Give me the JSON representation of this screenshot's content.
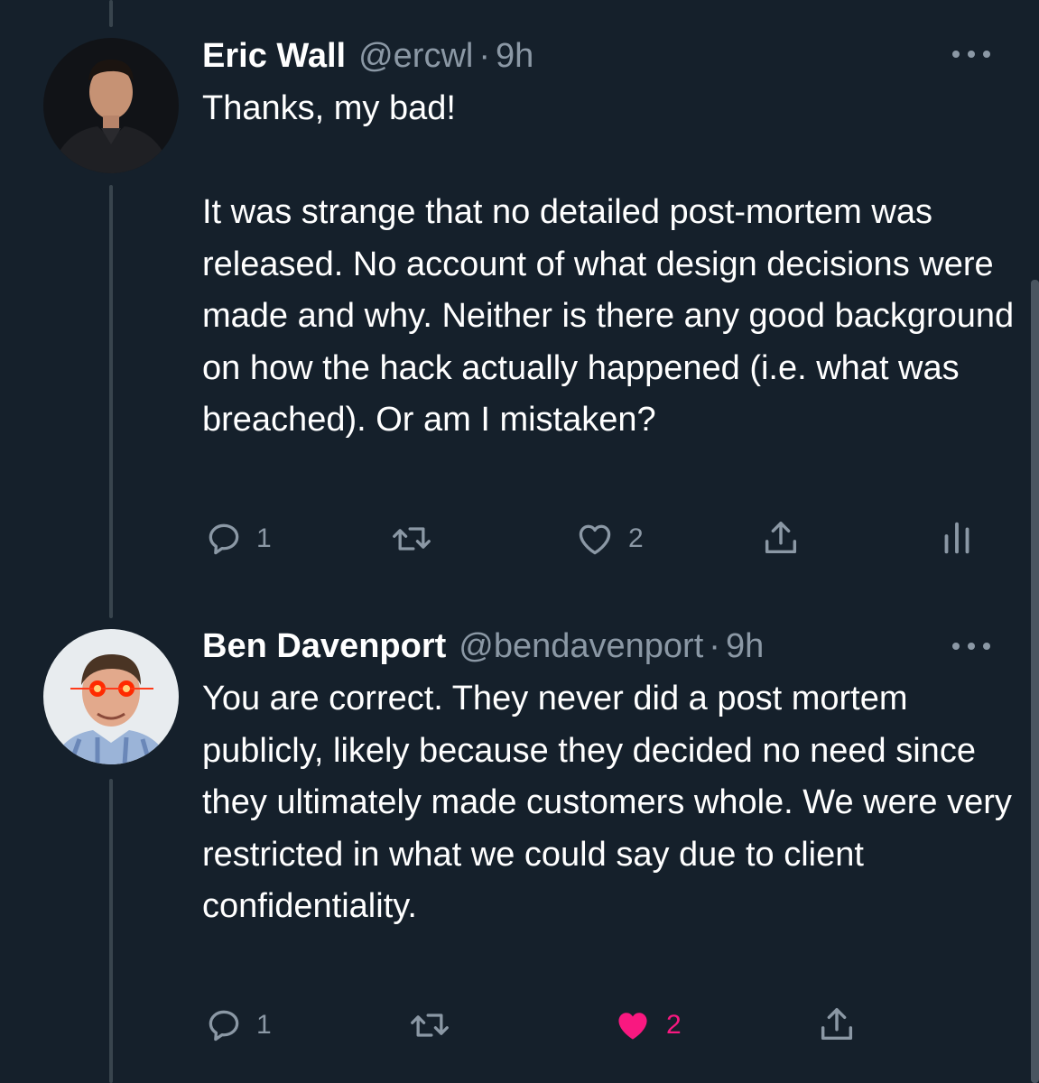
{
  "tweets": [
    {
      "name": "Eric Wall",
      "handle": "@ercwl",
      "separator": "·",
      "time": "9h",
      "avatar_icon": "avatar-photo-eric-wall",
      "text": "Thanks, my bad!\n\nIt was strange that no detailed post-mortem was released. No account of what design decisions were made and why. Neither is there any good background on how the hack actually happened (i.e. what was breached). Or am I mistaken?",
      "actions": {
        "reply_count": "1",
        "retweet_count": "",
        "like_count": "2",
        "liked": false,
        "show_analytics": true
      }
    },
    {
      "name": "Ben Davenport",
      "handle": "@bendavenport",
      "separator": "·",
      "time": "9h",
      "avatar_icon": "avatar-photo-ben-davenport-laser-eyes",
      "text": "You are correct. They never did a post mortem publicly, likely because they decided no need since they ultimately made customers whole. We were very restricted in what we could say due to client confidentiality.",
      "actions": {
        "reply_count": "1",
        "retweet_count": "",
        "like_count": "2",
        "liked": true,
        "show_analytics": false
      }
    }
  ],
  "colors": {
    "background": "#15202b",
    "text_primary": "#ffffff",
    "text_secondary": "#8b98a5",
    "thread_line": "#38444d",
    "like_active": "#f91880"
  }
}
